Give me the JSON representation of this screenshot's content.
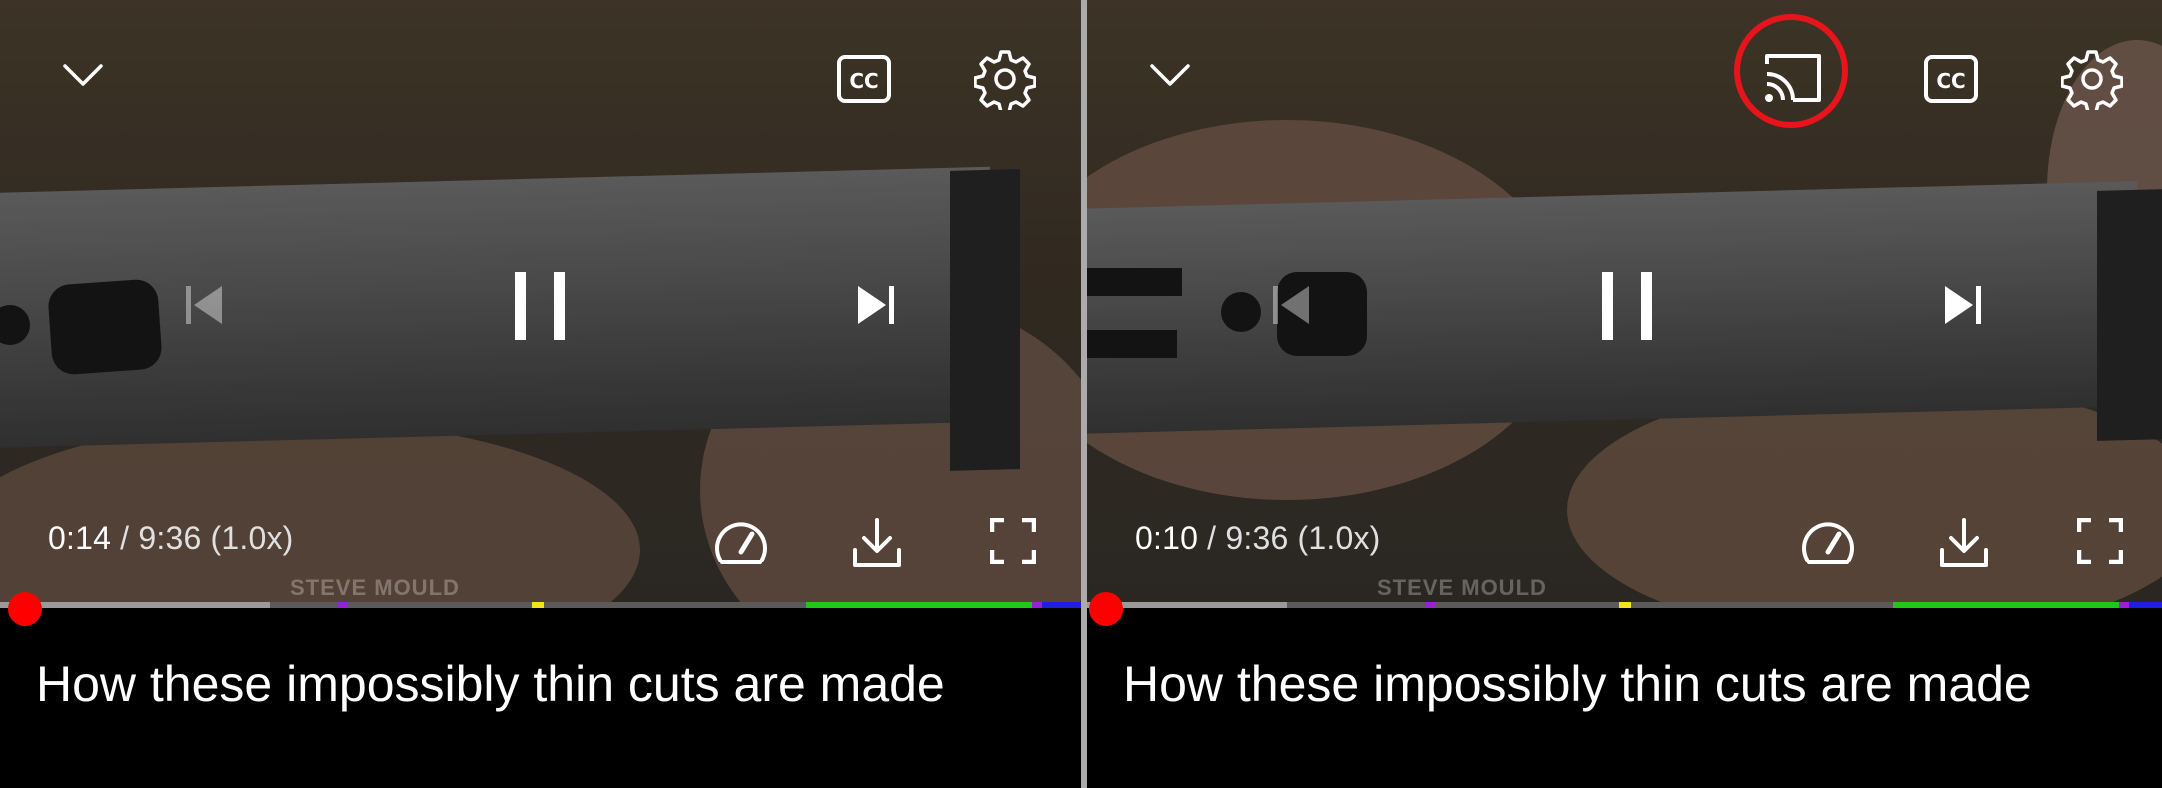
{
  "screens": [
    {
      "time": {
        "current": "0:14",
        "separator": " / ",
        "duration": "9:36 (1.0x)"
      },
      "watermark": "STEVE MOULD",
      "title": "How these impossibly thin cuts are made",
      "progress": {
        "played_fraction": 0.024,
        "buffered_fraction": 0.25
      },
      "top_controls": [
        "chevron-down-icon",
        "closed-captions-icon",
        "settings-gear-icon"
      ],
      "center_controls": [
        "previous-icon",
        "pause-icon",
        "next-icon"
      ],
      "bottom_controls": [
        "playback-speed-icon",
        "download-icon",
        "fullscreen-icon"
      ]
    },
    {
      "time": {
        "current": "0:10",
        "separator": " / ",
        "duration": "9:36 (1.0x)"
      },
      "watermark": "STEVE MOULD",
      "title": "How these impossibly thin cuts are made",
      "progress": {
        "played_fraction": 0.017,
        "buffered_fraction": 0.19
      },
      "top_controls": [
        "chevron-down-icon",
        "cast-icon",
        "closed-captions-icon",
        "settings-gear-icon"
      ],
      "center_controls": [
        "previous-icon",
        "pause-icon",
        "next-icon"
      ],
      "bottom_controls": [
        "playback-speed-icon",
        "download-icon",
        "fullscreen-icon"
      ],
      "highlighted_control": "cast-icon"
    }
  ],
  "colors": {
    "scrubber": "#ff0000",
    "chapter_green": "#22c51e",
    "chapter_blue": "#1e1ee6",
    "chapter_purple": "#9a1fd6",
    "chapter_yellow": "#f2e51a",
    "highlight_ring": "#e8141b"
  }
}
